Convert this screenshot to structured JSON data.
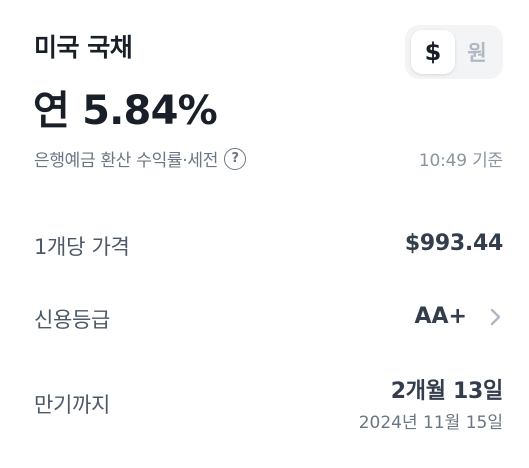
{
  "header": {
    "title": "미국 국채",
    "rate": "연 5.84%"
  },
  "currency_toggle": {
    "options": [
      "$",
      "원"
    ],
    "selected": "$"
  },
  "note": {
    "text": "은행예금 환산 수익률·세전",
    "help_icon": "question-circle-icon",
    "time": "10:49 기준"
  },
  "details": {
    "price": {
      "label": "1개당 가격",
      "value": "$993.44"
    },
    "rating": {
      "label": "신용등급",
      "value": "AA+",
      "icon": "chevron-right-icon"
    },
    "maturity": {
      "label": "만기까지",
      "value": "2개월 13일",
      "date": "2024년 11월 15일"
    }
  },
  "colors": {
    "text_primary": "#191f28",
    "text_secondary": "#4e5968",
    "text_muted": "#8b95a1",
    "toggle_bg": "#f2f4f6",
    "toggle_inactive": "#b0b8c1"
  }
}
